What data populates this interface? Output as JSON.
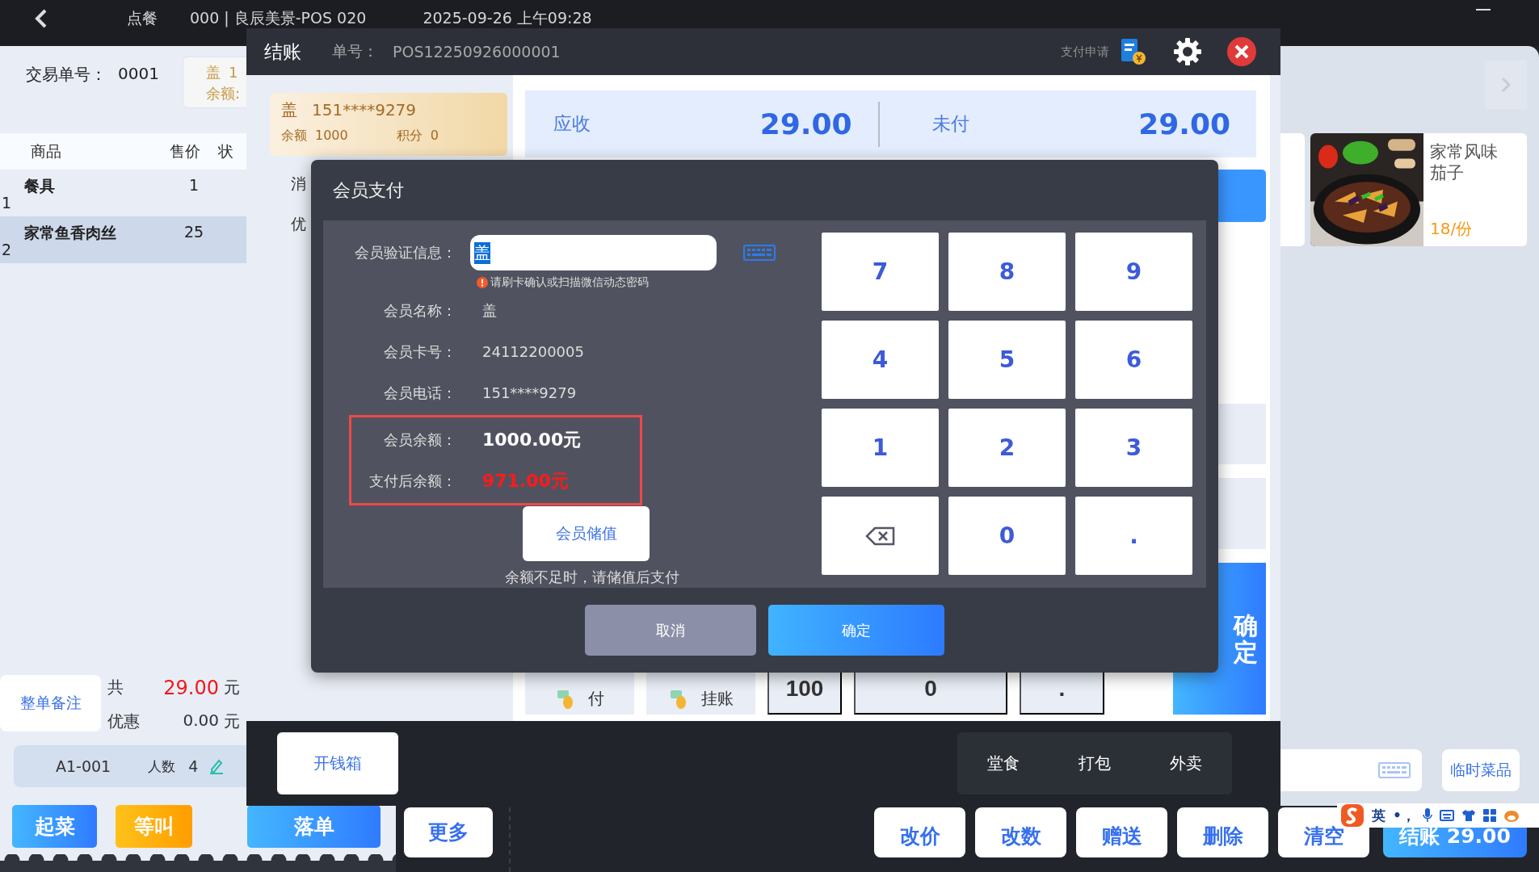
{
  "top_bar": {
    "title": "点餐",
    "store": "000 | 良辰美景-POS 020",
    "datetime": "2025-09-26 上午09:28"
  },
  "order_panel": {
    "trade_no_label": "交易单号：",
    "trade_no": "0001",
    "member_chip": {
      "name": "盖",
      "phone": "1",
      "balance_label": "余额:"
    },
    "columns": [
      "商品",
      "售价",
      "状"
    ],
    "rows": [
      {
        "index": "1",
        "name": "餐具",
        "price": "1",
        "selected": false
      },
      {
        "index": "2",
        "name": "家常鱼香肉丝",
        "price": "25",
        "selected": true
      }
    ],
    "remark_button": "整单备注",
    "total_label": "共",
    "total": "29.00",
    "total_unit": "元",
    "discount_label": "优惠",
    "discount": "0.00",
    "discount_unit": "元",
    "table": "A1-001",
    "guests_label": "人数",
    "guests": "4",
    "actions": [
      {
        "label": "起菜",
        "kind": "primary"
      },
      {
        "label": "等叫",
        "kind": "warning"
      },
      {
        "label": "落单",
        "kind": "primary"
      }
    ]
  },
  "right_panel": {
    "products": [
      {
        "name": "家常风味茄子",
        "price": "18/份",
        "kind": "picture"
      }
    ],
    "temp_dish": "临时菜品"
  },
  "bottom_bar": {
    "more": "更多",
    "actions": [
      "改价",
      "改数",
      "赠送",
      "删除",
      "清空"
    ],
    "checkout": "结账 29.00"
  },
  "checkout_dialog": {
    "title": "结账",
    "order_no_label": "单号：",
    "order_no": "POS12250926000001",
    "pay_request": "支付申请",
    "member": {
      "name": "盖",
      "phone": "151****9279",
      "balance_label": "余额",
      "balance": "1000",
      "points_label": "积分",
      "points": "0"
    },
    "side_labels": [
      "消",
      "优"
    ],
    "receivable_label": "应收",
    "receivable": "29.00",
    "unpaid_label": "未付",
    "unpaid": "29.00",
    "bottom_row": [
      {
        "kind": "method",
        "label": "付"
      },
      {
        "kind": "method",
        "label": "挂账"
      },
      {
        "kind": "key",
        "label": "100"
      },
      {
        "kind": "key",
        "label": "0"
      },
      {
        "kind": "key",
        "label": "."
      }
    ],
    "confirm": "确定",
    "cash_drawer": "开钱箱",
    "order_types": [
      "堂食",
      "打包",
      "外卖"
    ]
  },
  "member_pay_dialog": {
    "title": "会员支付",
    "verify_label": "会员验证信息：",
    "verify_value": "盖",
    "hint": "请刷卡确认或扫描微信动态密码",
    "fields": [
      {
        "label": "会员名称：",
        "value": "盖",
        "kind": "plain"
      },
      {
        "label": "会员卡号：",
        "value": "24112200005",
        "kind": "plain"
      },
      {
        "label": "会员电话：",
        "value": "151****9279",
        "kind": "plain"
      },
      {
        "label": "会员余额：",
        "value": "1000.00元",
        "kind": "balance"
      },
      {
        "label": "支付后余额：",
        "value": "971.00元",
        "kind": "after"
      }
    ],
    "recharge": "会员储值",
    "note": "余额不足时，请储值后支付",
    "keys": [
      {
        "kind": "digit",
        "label": "7"
      },
      {
        "kind": "digit",
        "label": "8"
      },
      {
        "kind": "digit",
        "label": "9"
      },
      {
        "kind": "digit",
        "label": "4"
      },
      {
        "kind": "digit",
        "label": "5"
      },
      {
        "kind": "digit",
        "label": "6"
      },
      {
        "kind": "digit",
        "label": "1"
      },
      {
        "kind": "digit",
        "label": "2"
      },
      {
        "kind": "digit",
        "label": "3"
      },
      {
        "kind": "backspace"
      },
      {
        "kind": "digit",
        "label": "0"
      },
      {
        "kind": "digit",
        "label": "."
      }
    ],
    "cancel": "取消",
    "ok": "确定"
  },
  "ime_bar": {
    "mode": "英",
    "punct": "•，"
  }
}
